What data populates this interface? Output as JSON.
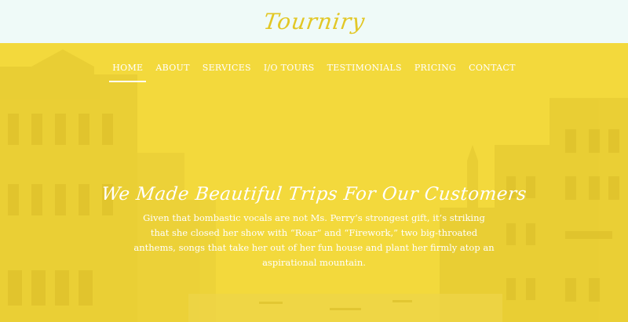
{
  "header": {
    "logo": "Tourniry"
  },
  "nav": {
    "items": [
      {
        "label": "HOME",
        "active": true
      },
      {
        "label": "ABOUT"
      },
      {
        "label": "SERVICES"
      },
      {
        "label": "I/O TOURS"
      },
      {
        "label": "TESTIMONIALS"
      },
      {
        "label": "PRICING"
      },
      {
        "label": "CONTACT"
      }
    ]
  },
  "hero": {
    "headline": "We Made Beautiful Trips For Our Customers",
    "description": "Given that bombastic vocals are not Ms. Perry’s strongest gift, it’s striking that she closed her show with “Roar” and “Firework,” two big-throated anthems, songs that take her out of her fun house and plant her firmly atop an aspirational mountain."
  },
  "colors": {
    "accent": "#f3d93c",
    "logo": "#e2c726",
    "topbar": "#effaf8",
    "text": "#ffffff"
  }
}
